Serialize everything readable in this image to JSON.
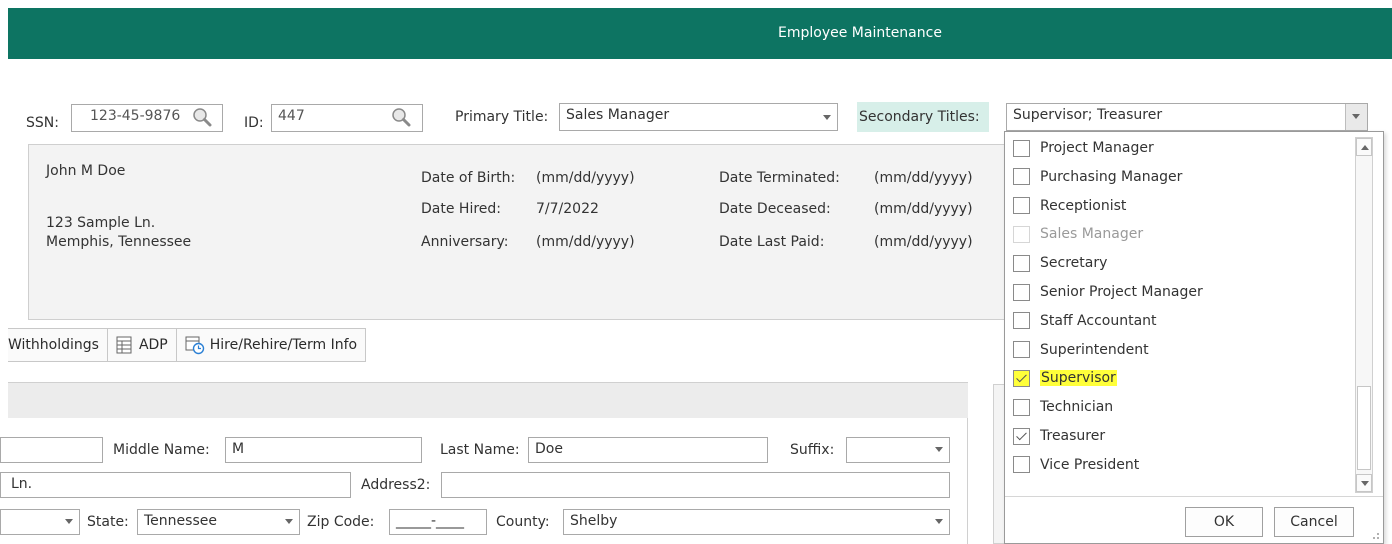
{
  "window": {
    "title": "Employee Maintenance"
  },
  "header": {
    "ssn_label": "SSN:",
    "ssn_value": "123-45-9876",
    "id_label": "ID:",
    "id_value": "447",
    "primary_title_label": "Primary Title:",
    "primary_title_value": "Sales Manager",
    "secondary_titles_label": "Secondary Titles:",
    "secondary_titles_value": "Supervisor; Treasurer"
  },
  "info": {
    "name": "John M Doe",
    "address1": "123 Sample Ln.",
    "address2": "Memphis, Tennessee",
    "dob_label": "Date of Birth:",
    "dob_value": "(mm/dd/yyyy)",
    "hired_label": "Date Hired:",
    "hired_value": "7/7/2022",
    "anniversary_label": "Anniversary:",
    "anniversary_value": "(mm/dd/yyyy)",
    "terminated_label": "Date Terminated:",
    "terminated_value": "(mm/dd/yyyy)",
    "deceased_label": "Date Deceased:",
    "deceased_value": "(mm/dd/yyyy)",
    "last_paid_label": "Date Last Paid:",
    "last_paid_value": "(mm/dd/yyyy)"
  },
  "tabs": [
    {
      "label": "Withholdings"
    },
    {
      "label": "ADP",
      "icon": "table-icon"
    },
    {
      "label": "Hire/Rehire/Term Info",
      "icon": "calendar-clock-icon"
    }
  ],
  "form": {
    "middle_name_label": "Middle Name:",
    "middle_name_value": "M",
    "last_name_label": "Last Name:",
    "last_name_value": "Doe",
    "suffix_label": "Suffix:",
    "suffix_value": "",
    "address1_value": "Ln.",
    "address2_label": "Address2:",
    "address2_value": "",
    "state_label": "State:",
    "state_value": "Tennessee",
    "zip_label": "Zip Code:",
    "zip_value": "_____-____",
    "county_label": "County:",
    "county_value": "Shelby"
  },
  "secondary_titles_dropdown": {
    "items": [
      {
        "label": "Project Manager",
        "checked": false,
        "disabled": false
      },
      {
        "label": "Purchasing Manager",
        "checked": false,
        "disabled": false
      },
      {
        "label": "Receptionist",
        "checked": false,
        "disabled": false
      },
      {
        "label": "Sales Manager",
        "checked": false,
        "disabled": true
      },
      {
        "label": "Secretary",
        "checked": false,
        "disabled": false
      },
      {
        "label": "Senior Project Manager",
        "checked": false,
        "disabled": false
      },
      {
        "label": "Staff Accountant",
        "checked": false,
        "disabled": false
      },
      {
        "label": "Superintendent",
        "checked": false,
        "disabled": false
      },
      {
        "label": "Supervisor",
        "checked": true,
        "disabled": false,
        "highlighted": true
      },
      {
        "label": "Technician",
        "checked": false,
        "disabled": false
      },
      {
        "label": "Treasurer",
        "checked": true,
        "disabled": false
      },
      {
        "label": "Vice President",
        "checked": false,
        "disabled": false
      }
    ],
    "ok_label": "OK",
    "cancel_label": "Cancel"
  },
  "colors": {
    "titlebar": "#0d7462",
    "secondary_label_bg": "#d7efe9",
    "highlight": "#ffff3a"
  }
}
